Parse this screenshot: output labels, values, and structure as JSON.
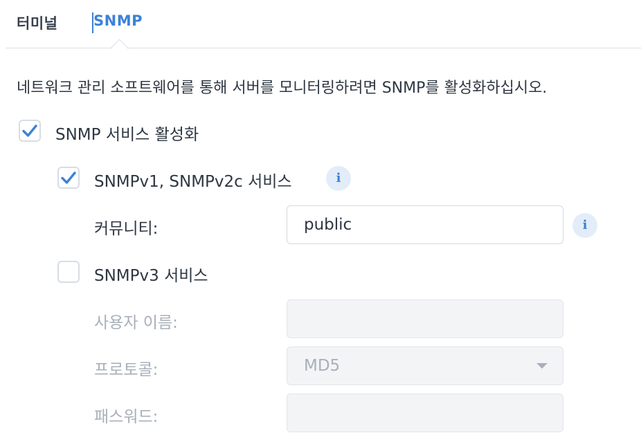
{
  "tabs": [
    {
      "label": "터미널"
    },
    {
      "label": "SNMP"
    }
  ],
  "description": "네트워크 관리 소프트웨어를 통해 서버를 모니터링하려면 SNMP를 활성화하십시오.",
  "snmp_enable": {
    "label": "SNMP 서비스 활성화",
    "checked": true
  },
  "v1v2c": {
    "label": "SNMPv1, SNMPv2c 서비스",
    "checked": true,
    "info_icon": "i"
  },
  "community": {
    "label": "커뮤니티:",
    "value": "public",
    "info_icon": "i"
  },
  "v3": {
    "label": "SNMPv3 서비스",
    "checked": false
  },
  "username": {
    "label": "사용자 이름:",
    "value": ""
  },
  "protocol": {
    "label": "프로토콜:",
    "value": "MD5"
  },
  "password": {
    "label": "패스워드:",
    "value": ""
  },
  "colors": {
    "accent": "#3b82d6",
    "text": "#2e3742",
    "disabled": "#a9b0b9"
  }
}
